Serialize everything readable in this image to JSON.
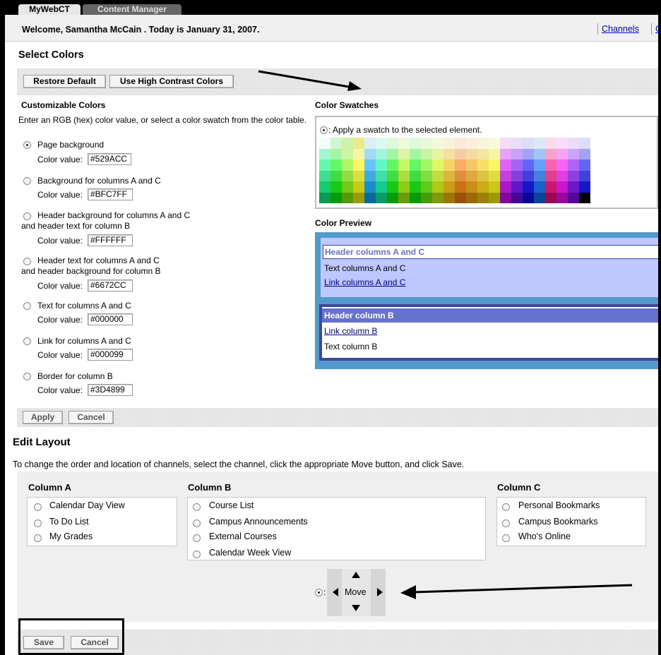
{
  "tabs": [
    {
      "label": "MyWebCT",
      "active": true
    },
    {
      "label": "Content Manager",
      "active": false
    }
  ],
  "welcome": {
    "text": "Welcome, Samantha McCain . Today is January 31, 2007.",
    "channels_link": "Channels",
    "second_link": "C"
  },
  "select_colors": {
    "title": "Select Colors",
    "restore_default": "Restore Default",
    "high_contrast": "Use High Contrast Colors"
  },
  "customizable": {
    "title": "Customizable Colors",
    "instructions": "Enter an RGB (hex) color value, or select a color swatch from the color table.",
    "value_label": "Color value:",
    "elements": [
      {
        "label": "Page background",
        "value": "#529ACC",
        "selected": true
      },
      {
        "label": "Background for columns A and C",
        "value": "#BFC7FF",
        "selected": false
      },
      {
        "label": "Header background for columns A and C",
        "label2": "and header text for column B",
        "value": "#FFFFFF",
        "selected": false
      },
      {
        "label": "Header text for columns A and C",
        "label2": "and header background for column B",
        "value": "#6672CC",
        "selected": false
      },
      {
        "label": "Text for columns A and C",
        "value": "#000000",
        "selected": false
      },
      {
        "label": "Link for columns A and C",
        "value": "#000099",
        "selected": false
      },
      {
        "label": "Border for column B",
        "value": "#3D4899",
        "selected": false
      }
    ]
  },
  "swatches": {
    "title": "Color Swatches",
    "radio_label": ": Apply a swatch to the selected element."
  },
  "preview": {
    "title": "Color Preview",
    "header_a": "Header columns A and C",
    "text_a": "Text columns A and C",
    "link_a": "Link columns A and C",
    "header_b": "Header column B",
    "link_b": "Link column B",
    "text_b": "Text column B",
    "colors": {
      "page": "#529ACC",
      "bg_ac": "#BFC7FF",
      "header_bg_ac": "#FFFFFF",
      "header_text_ac": "#6672CC",
      "text_ac": "#000000",
      "link_ac": "#000099",
      "border_b": "#3D4899"
    }
  },
  "apply_bar": {
    "apply": "Apply",
    "cancel": "Cancel"
  },
  "edit_layout": {
    "title": "Edit Layout",
    "instructions": "To change the order and location of channels, select the channel, click the appropriate Move button, and click Save.",
    "column_a": {
      "title": "Column A",
      "items": [
        "Calendar Day View",
        "To Do List",
        "My Grades"
      ]
    },
    "column_b": {
      "title": "Column B",
      "items": [
        "Course List",
        "Campus Announcements",
        "External Courses",
        "Calendar Week View"
      ]
    },
    "column_c": {
      "title": "Column C",
      "items": [
        "Personal Bookmarks",
        "Campus Bookmarks",
        "Who's Online"
      ]
    },
    "move_label": "Move",
    "move_radio_colon": ":"
  },
  "save_bar": {
    "save": "Save",
    "cancel": "Cancel"
  }
}
